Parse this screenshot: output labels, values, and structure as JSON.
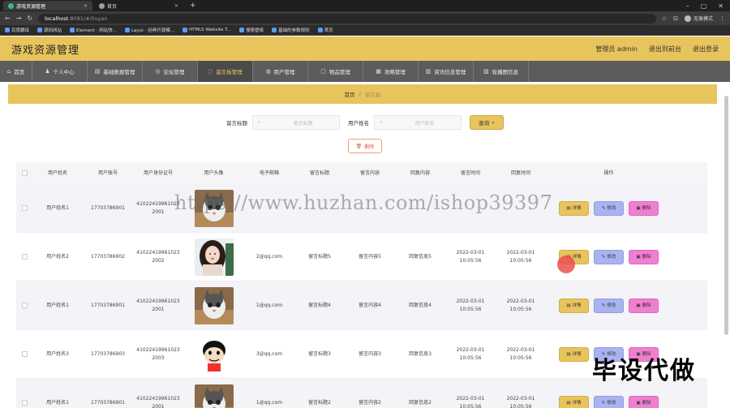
{
  "browser": {
    "tabs": [
      {
        "label": "游戏资源管理",
        "active": true
      },
      {
        "label": "首页",
        "active": false
      }
    ],
    "url_host": "localhost",
    "url_path": ":8081/#/liuyan",
    "profile_label": "无痕模式",
    "bookmarks": [
      "百度翻译",
      "源码网站",
      "Element - 网站快...",
      "Layui - 经典开源模...",
      "HTML5 Website T...",
      "搜索壁纸",
      "基础的参数规则",
      "首页"
    ]
  },
  "header": {
    "title": "游戏资源管理",
    "links": [
      "管理员 admin",
      "退出到前台",
      "退出登录"
    ]
  },
  "nav": [
    {
      "label": "首页",
      "icon": "⌂"
    },
    {
      "label": "个人中心",
      "icon": "♟"
    },
    {
      "label": "基础数据管理",
      "icon": "▤"
    },
    {
      "label": "论坛管理",
      "icon": "◎"
    },
    {
      "label": "留言板管理",
      "icon": "◌",
      "active": true
    },
    {
      "label": "用户管理",
      "icon": "◍"
    },
    {
      "label": "物品管理",
      "icon": "▢"
    },
    {
      "label": "攻略管理",
      "icon": "▦"
    },
    {
      "label": "资讯信息管理",
      "icon": "▥"
    },
    {
      "label": "轮播图信息",
      "icon": "▧"
    }
  ],
  "breadcrumb": {
    "home": "首页",
    "separator": "/",
    "current": "留言板"
  },
  "search": {
    "title_label": "留言标题",
    "title_placeholder": "留言标题",
    "user_label": "用户姓名",
    "user_placeholder": "用户姓名",
    "query_label": "查询"
  },
  "delete_label": "删除",
  "table": {
    "headers": [
      "用户姓名",
      "用户账号",
      "用户身份证号",
      "用户头像",
      "电子邮箱",
      "留言标题",
      "留言内容",
      "回复内容",
      "留言时间",
      "回复时间",
      "操作"
    ],
    "ops": {
      "detail": "详情",
      "edit": "修改",
      "delete": "删除"
    },
    "rows": [
      {
        "name": "用户姓名1",
        "account": "17703786901",
        "idcard": "410224199610232001",
        "avatar": "cat",
        "email": "",
        "title": "",
        "content": "",
        "reply": "",
        "time": "",
        "rtime": ""
      },
      {
        "name": "用户姓名2",
        "account": "17703786902",
        "idcard": "410224199610232002",
        "avatar": "girl",
        "email": "2@qq.com",
        "title": "留言标题5",
        "content": "留言内容5",
        "reply": "回复信息5",
        "time": "2022-03-01 10:05:56",
        "rtime": "2022-03-01 10:05:56"
      },
      {
        "name": "用户姓名1",
        "account": "17703786901",
        "idcard": "410224199610232001",
        "avatar": "cat",
        "email": "1@qq.com",
        "title": "留言标题4",
        "content": "留言内容4",
        "reply": "回复信息4",
        "time": "2022-03-01 10:05:56",
        "rtime": "2022-03-01 10:05:56"
      },
      {
        "name": "用户姓名3",
        "account": "17703786903",
        "idcard": "410224199610232003",
        "avatar": "cartoon",
        "email": "3@qq.com",
        "title": "留言标题3",
        "content": "留言内容3",
        "reply": "回复信息3",
        "time": "2022-03-01 10:05:56",
        "rtime": "2022-03-01 10:05:56"
      },
      {
        "name": "用户姓名1",
        "account": "17703786901",
        "idcard": "410224199610232001",
        "avatar": "cat",
        "email": "1@qq.com",
        "title": "留言标题2",
        "content": "留言内容2",
        "reply": "回复信息2",
        "time": "2022-03-01 10:05:56",
        "rtime": "2022-03-01 10:05:56"
      }
    ]
  },
  "overlay": {
    "watermark": "https://www.huzhan.com/ishop39397",
    "corner_text": "毕设代做"
  }
}
